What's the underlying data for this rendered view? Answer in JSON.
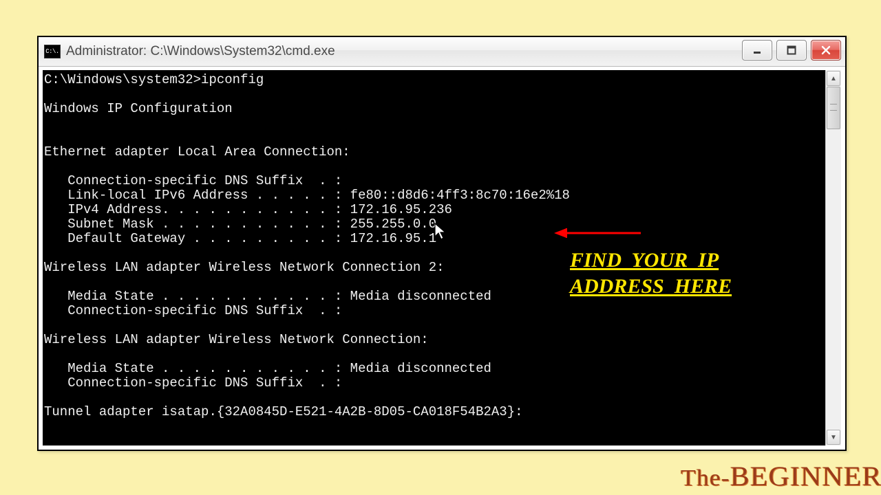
{
  "window": {
    "icon_label": "C:\\.",
    "title": "Administrator: C:\\Windows\\System32\\cmd.exe"
  },
  "console": {
    "prompt": "C:\\Windows\\system32>",
    "command": "ipconfig",
    "header": "Windows IP Configuration",
    "adapters": [
      {
        "title": "Ethernet adapter Local Area Connection:",
        "lines": [
          "   Connection-specific DNS Suffix  . :",
          "   Link-local IPv6 Address . . . . . : fe80::d8d6:4ff3:8c70:16e2%18",
          "   IPv4 Address. . . . . . . . . . . : 172.16.95.236",
          "   Subnet Mask . . . . . . . . . . . : 255.255.0.0",
          "   Default Gateway . . . . . . . . . : 172.16.95.1"
        ]
      },
      {
        "title": "Wireless LAN adapter Wireless Network Connection 2:",
        "lines": [
          "   Media State . . . . . . . . . . . : Media disconnected",
          "   Connection-specific DNS Suffix  . :"
        ]
      },
      {
        "title": "Wireless LAN adapter Wireless Network Connection:",
        "lines": [
          "   Media State . . . . . . . . . . . : Media disconnected",
          "   Connection-specific DNS Suffix  . :"
        ]
      }
    ],
    "tail": "Tunnel adapter isatap.{32A0845D-E521-4A2B-8D05-CA018F54B2A3}:"
  },
  "annotation": {
    "callout": "FIND  YOUR  IP\nADDRESS  HERE"
  },
  "watermark": {
    "text_small": "The-",
    "text_big": "BEGINNER"
  }
}
